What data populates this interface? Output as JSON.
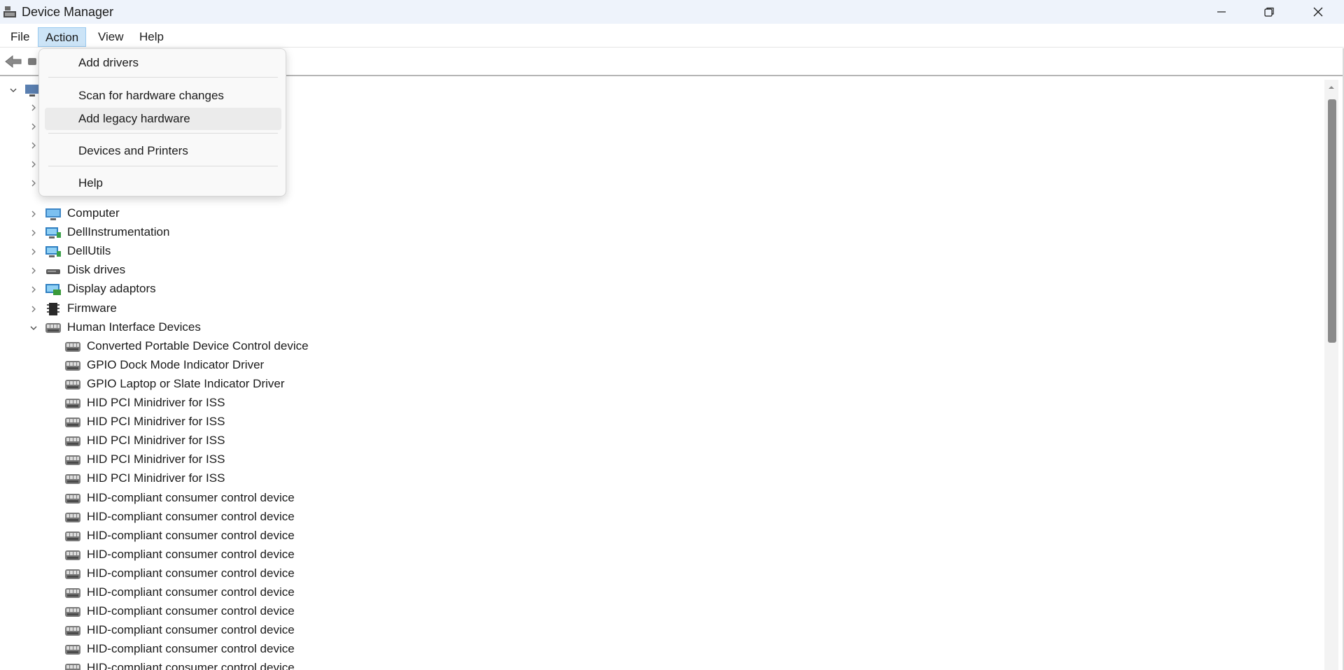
{
  "window": {
    "title": "Device Manager",
    "controls": {
      "minimize_icon": "minimize-icon",
      "restore_icon": "restore-icon",
      "close_icon": "close-icon"
    }
  },
  "menubar": {
    "items": [
      {
        "label": "File",
        "active": false
      },
      {
        "label": "Action",
        "active": true
      },
      {
        "label": "View",
        "active": false
      },
      {
        "label": "Help",
        "active": false
      }
    ]
  },
  "toolbar": {
    "back_icon": "back-arrow-icon"
  },
  "action_menu": {
    "items": [
      {
        "label": "Add drivers",
        "hover": false
      },
      {
        "label": "Scan for hardware changes",
        "hover": false
      },
      {
        "label": "Add legacy hardware",
        "hover": true
      },
      {
        "label": "Devices and Printers",
        "hover": false
      },
      {
        "label": "Help",
        "hover": false
      }
    ]
  },
  "tree": {
    "categories": [
      {
        "label": "Computer",
        "icon": "computer-icon",
        "expanded": false
      },
      {
        "label": "DellInstrumentation",
        "icon": "monitor-network-icon",
        "expanded": false
      },
      {
        "label": "DellUtils",
        "icon": "monitor-network-icon",
        "expanded": false
      },
      {
        "label": "Disk drives",
        "icon": "disk-drive-icon",
        "expanded": false
      },
      {
        "label": "Display adaptors",
        "icon": "display-adapter-icon",
        "expanded": false
      },
      {
        "label": "Firmware",
        "icon": "firmware-chip-icon",
        "expanded": false
      },
      {
        "label": "Human Interface Devices",
        "icon": "hid-icon",
        "expanded": true
      }
    ],
    "hid_children": [
      "Converted Portable Device Control device",
      "GPIO Dock Mode Indicator Driver",
      "GPIO Laptop or Slate Indicator Driver",
      "HID PCI Minidriver for ISS",
      "HID PCI Minidriver for ISS",
      "HID PCI Minidriver for ISS",
      "HID PCI Minidriver for ISS",
      "HID PCI Minidriver for ISS",
      "HID-compliant consumer control device",
      "HID-compliant consumer control device",
      "HID-compliant consumer control device",
      "HID-compliant consumer control device",
      "HID-compliant consumer control device",
      "HID-compliant consumer control device",
      "HID-compliant consumer control device",
      "HID-compliant consumer control device",
      "HID-compliant consumer control device",
      "HID-compliant consumer control device"
    ]
  },
  "colors": {
    "titlebar_bg": "#eef3fb",
    "menu_active_bg": "#cce4f7",
    "menu_hover_bg": "#ebebeb",
    "scroll_thumb": "#8a8a8a"
  }
}
